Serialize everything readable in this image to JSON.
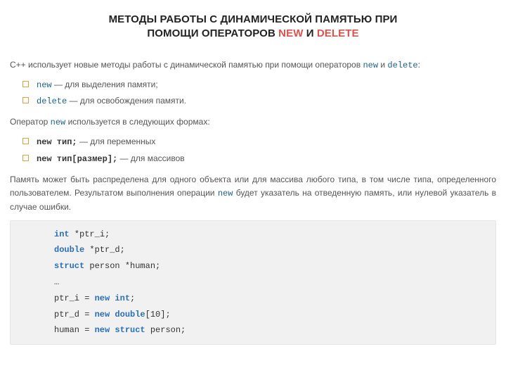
{
  "title": {
    "line1_pre": "МЕТОДЫ РАБОТЫ С ДИНАМИЧЕСКОЙ ПАМЯТЬЮ ПРИ",
    "line2_pre": "ПОМОЩИ ОПЕРАТОРОВ ",
    "kw1": "NEW",
    "mid": " И ",
    "kw2": "DELETE"
  },
  "lead": {
    "pre": "С++ использует новые методы работы с динамической памятью при помощи операторов ",
    "op1": "new",
    "mid": " и ",
    "op2": "delete",
    "post": ":"
  },
  "bullets1": [
    {
      "code": "new",
      "text": " — для выделения памяти;"
    },
    {
      "code": "delete",
      "text": " — для освобождения памяти."
    }
  ],
  "para2": {
    "pre": "Оператор ",
    "op": "new",
    "post": " используется в следующих формах:"
  },
  "bullets2": [
    {
      "bold": "new тип;",
      "text": " — для переменных"
    },
    {
      "bold": "new тип[размер];",
      "text": " — для массивов"
    }
  ],
  "para3": {
    "pre": "Память может быть распределена для одного объекта или для массива любого типа, в том числе типа, определенного пользователем. Результатом выполнения операции ",
    "op": "new",
    "post": " будет указатель на отведенную память, или нулевой указатель в случае ошибки."
  },
  "code": {
    "l1_kw": "int",
    "l1_rest": " *ptr_i;",
    "l2_kw": "double",
    "l2_rest": " *ptr_d;",
    "l3_kw": "struct",
    "l3_rest": " person *human;",
    "l4": "…",
    "l5_pre": "ptr_i = ",
    "l5_new": "new",
    "l5_sp": " ",
    "l5_kw": "int",
    "l5_post": ";",
    "l6_pre": "ptr_d = ",
    "l6_new": "new",
    "l6_sp": " ",
    "l6_kw": "double",
    "l6_post": "[10];",
    "l7_pre": "human = ",
    "l7_new": "new",
    "l7_sp": " ",
    "l7_kw": "struct",
    "l7_post": " person;"
  }
}
